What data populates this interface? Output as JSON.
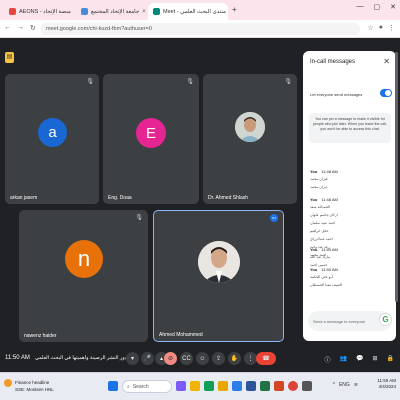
{
  "browser": {
    "tabs": [
      {
        "label": "AEONS - منصة الإتحاد",
        "favicon_color": "#e6463c"
      },
      {
        "label": "جامعة الإتحاد المجتمع",
        "favicon_color": "#4a8bd8"
      },
      {
        "label": "Meet - منتدى البحث العلمي",
        "favicon_color": "#00897b"
      }
    ],
    "url": "meet.google.com/chi-kuzd-fbm?authuser=0"
  },
  "participants": [
    {
      "name": "arkan jasem",
      "initial": "a",
      "color": "#1967d2"
    },
    {
      "name": "Eng. Doaa",
      "initial": "E",
      "color": "#e52592"
    },
    {
      "name": "Dr. Ahmed Shlash",
      "initial": "",
      "color": ""
    },
    {
      "name": "nawenz haider",
      "initial": "n",
      "color": "#e8710a"
    },
    {
      "name": "Ahmed Mohammed",
      "initial": "",
      "color": ""
    }
  ],
  "chat": {
    "title": "In-call messages",
    "toggle_label": "Let everyone send messages",
    "info": "You can pin a message to make it visible for people who join later. When you leave the call, you won't be able to access this chat.",
    "groups": [
      {
        "sender": "You",
        "time": "11:48 AM",
        "lines": [
          "فيزان محمد",
          "ديزان محمد"
        ]
      },
      {
        "sender": "You",
        "time": "11:48 AM",
        "lines": [
          "الحمدلله سعد",
          "اركان جاسم علوان",
          "احمد عبيد سلمان",
          "خليل ابراهيم",
          "احمد عبدالرزاق",
          "رعد عبد وحيد",
          "احمد محمد"
        ]
      },
      {
        "sender": "You",
        "time": "11:50 AM",
        "lines": [
          "تبارك عبد الله",
          "حسين احمد"
        ]
      },
      {
        "sender": "You",
        "time": "11:50 AM",
        "lines": [
          "أبو علي الحكمة",
          "الضيف معنا الخسطان"
        ]
      }
    ],
    "send_placeholder": "Send a message to everyone"
  },
  "meetbar": {
    "time": "11:50 AM",
    "meeting_name": "دور النشر الرصينة واهميتها في البحث العلمي"
  },
  "taskbar": {
    "weather_title": "Finance headline",
    "weather_sub": "SSE: Mostsen HNL",
    "search_label": "Search",
    "tray_time": "11:50 AM",
    "tray_date": "4/4/2024",
    "tray_icons": "ENG"
  }
}
